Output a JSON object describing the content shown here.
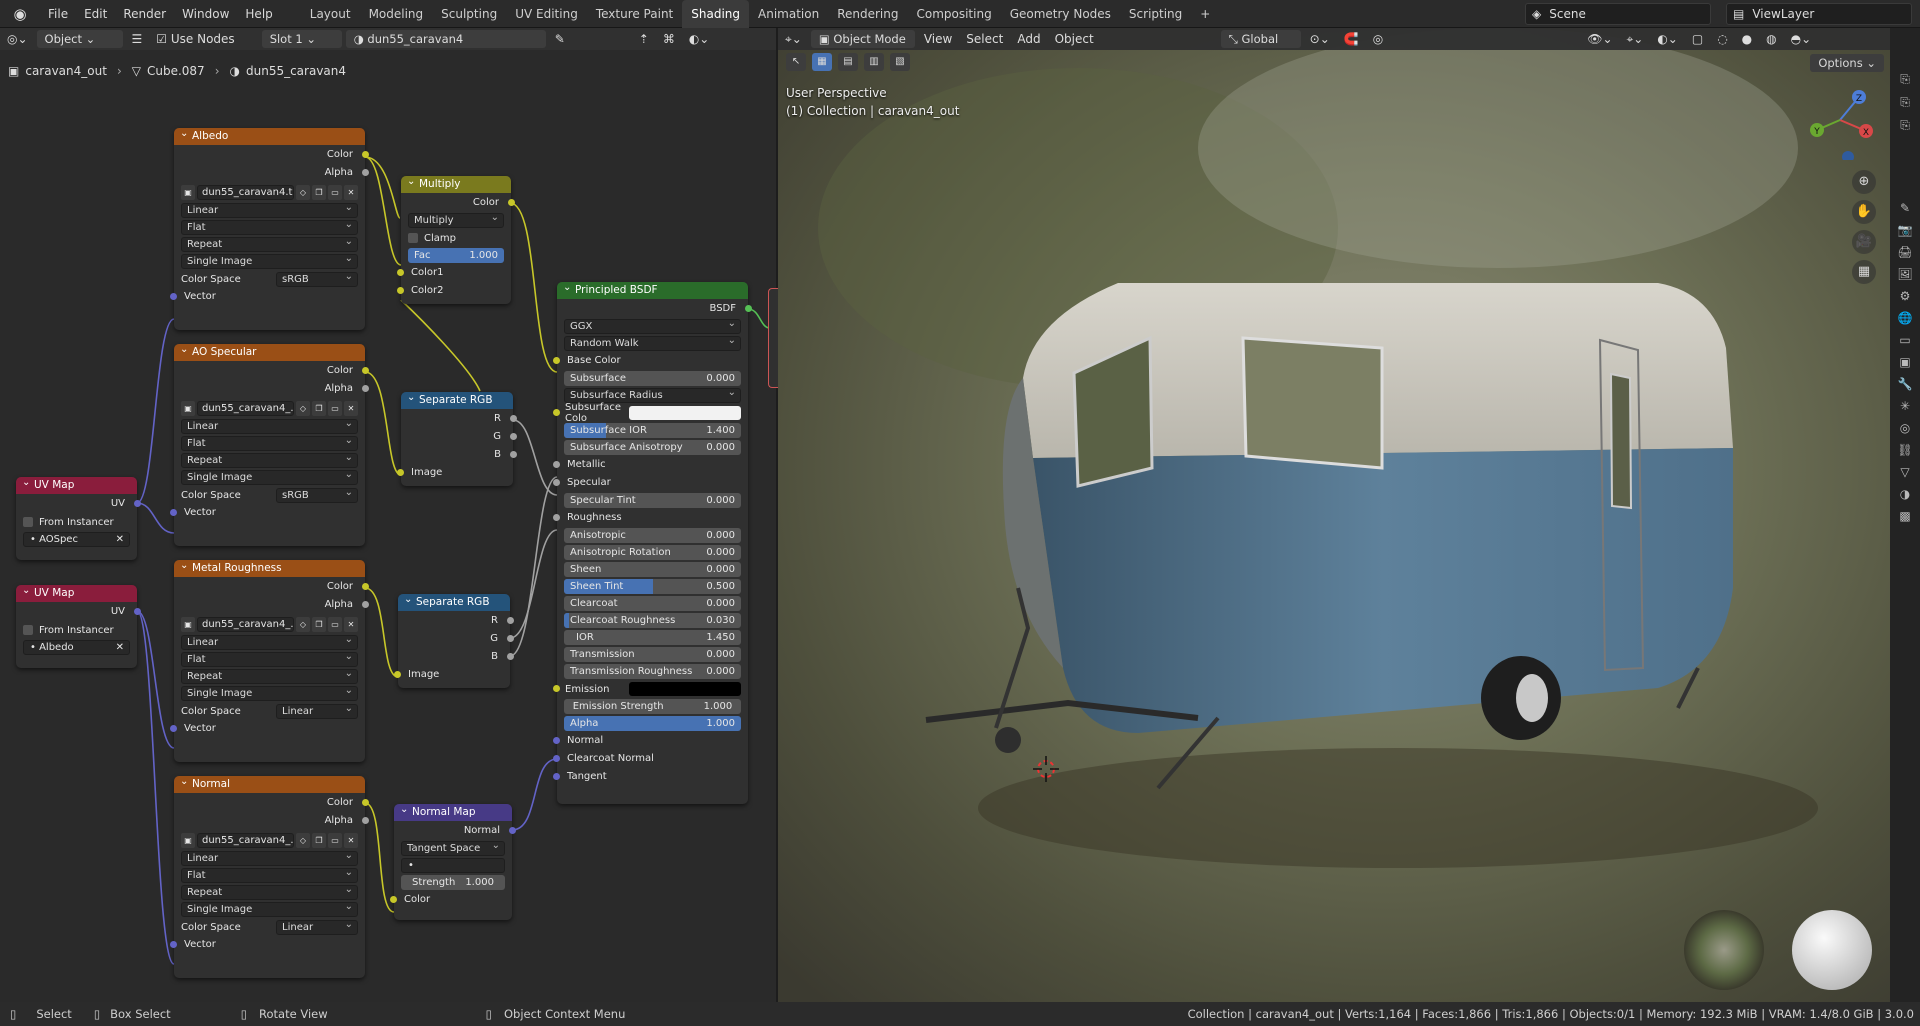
{
  "menu": {
    "items": [
      "File",
      "Edit",
      "Render",
      "Window",
      "Help"
    ]
  },
  "workspaces": [
    "Layout",
    "Modeling",
    "Sculpting",
    "UV Editing",
    "Texture Paint",
    "Shading",
    "Animation",
    "Rendering",
    "Compositing",
    "Geometry Nodes",
    "Scripting"
  ],
  "active_workspace": "Shading",
  "plus": "+",
  "scene": "Scene",
  "view_layer": "ViewLayer",
  "ne_header": {
    "mode": "Object",
    "use_nodes": "Use Nodes",
    "slot": "Slot 1",
    "material": "dun55_caravan4"
  },
  "breadcrumb": [
    "caravan4_out",
    "Cube.087",
    "dun55_caravan4"
  ],
  "vp_header": {
    "mode": "Object Mode",
    "menus": [
      "View",
      "Select",
      "Add",
      "Object"
    ],
    "transform": "Global",
    "options": "Options"
  },
  "vp_overlay": {
    "line1": "User Perspective",
    "line2": "(1) Collection | caravan4_out"
  },
  "gizmo": {
    "z": "Z",
    "y": "Y",
    "x": "X"
  },
  "common": {
    "color": "Color",
    "alpha": "Alpha",
    "vector": "Vector",
    "linear": "Linear",
    "flat": "Flat",
    "repeat": "Repeat",
    "single_image": "Single Image",
    "color_space": "Color Space",
    "srgb": "sRGB",
    "image": "Image",
    "r": "R",
    "g": "G",
    "b": "B",
    "uv": "UV",
    "from_instancer": "From Instancer"
  },
  "nodes": {
    "albedo": {
      "title": "Albedo",
      "image": "dun55_caravan4.t..."
    },
    "aospec": {
      "title": "AO Specular",
      "image": "dun55_caravan4_..."
    },
    "metal": {
      "title": "Metal Roughness",
      "image": "dun55_caravan4_...",
      "cs": "Linear"
    },
    "normal": {
      "title": "Normal",
      "image": "dun55_caravan4_...",
      "cs": "Linear"
    },
    "uv1": {
      "title": "UV Map",
      "map": "AOSpec"
    },
    "uv2": {
      "title": "UV Map",
      "map": "Albedo"
    },
    "multiply": {
      "title": "Multiply",
      "blend": "Multiply",
      "clamp": "Clamp",
      "fac_label": "Fac",
      "fac": "1.000",
      "color1": "Color1",
      "color2": "Color2"
    },
    "sep1": {
      "title": "Separate RGB"
    },
    "sep2": {
      "title": "Separate RGB"
    },
    "normalmap": {
      "title": "Normal Map",
      "out": "Normal",
      "space": "Tangent Space",
      "uvfield": "•",
      "strength_label": "Strength",
      "strength": "1.000",
      "color": "Color"
    },
    "bsdf": {
      "title": "Principled BSDF",
      "out": "BSDF",
      "dist": "GGX",
      "sss_method": "Random Walk",
      "base_color": "Base Color",
      "subsurface": "Subsurface",
      "subsurface_v": "0.000",
      "sss_radius": "Subsurface Radius",
      "sss_color": "Subsurface Colo",
      "sss_ior": "Subsurface IOR",
      "sss_ior_v": "1.400",
      "sss_aniso": "Subsurface Anisotropy",
      "sss_aniso_v": "0.000",
      "metallic": "Metallic",
      "specular": "Specular",
      "spec_tint": "Specular Tint",
      "spec_tint_v": "0.000",
      "roughness": "Roughness",
      "aniso": "Anisotropic",
      "aniso_v": "0.000",
      "aniso_rot": "Anisotropic Rotation",
      "aniso_rot_v": "0.000",
      "sheen": "Sheen",
      "sheen_v": "0.000",
      "sheen_tint": "Sheen Tint",
      "sheen_tint_v": "0.500",
      "clearcoat": "Clearcoat",
      "clearcoat_v": "0.000",
      "cc_rough": "Clearcoat Roughness",
      "cc_rough_v": "0.030",
      "ior": "IOR",
      "ior_v": "1.450",
      "trans": "Transmission",
      "trans_v": "0.000",
      "trans_rough": "Transmission Roughness",
      "trans_rough_v": "0.000",
      "emission": "Emission",
      "em_strength": "Emission Strength",
      "em_strength_v": "1.000",
      "alpha": "Alpha",
      "alpha_v": "1.000",
      "normal": "Normal",
      "cc_normal": "Clearcoat Normal",
      "tangent": "Tangent"
    }
  },
  "status": {
    "select": "Select",
    "box_select": "Box Select",
    "rotate": "Rotate View",
    "context": "Object Context Menu",
    "info": "Collection | caravan4_out | Verts:1,164 | Faces:1,866 | Tris:1,866 | Objects:0/1 | Memory: 192.3 MiB | VRAM: 1.4/8.0 GiB | 3.0.0"
  },
  "colors": {
    "texture_header": "#9a4f16",
    "uvmap_header": "#8a1d3c",
    "converter_header": "#24537a",
    "color_header": "#7a7a1e",
    "vector_header": "#473a86",
    "shader_header": "#2a6c2a"
  }
}
